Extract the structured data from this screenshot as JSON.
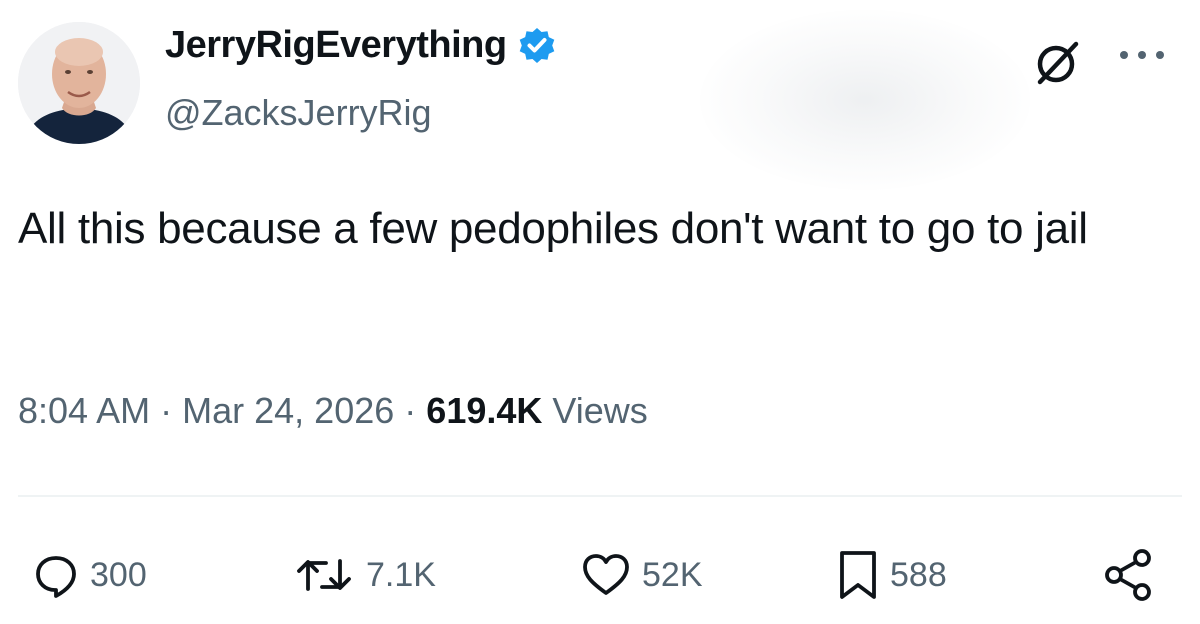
{
  "author": {
    "display_name": "JerryRigEverything",
    "handle": "@ZacksJerryRig",
    "verified": true
  },
  "tweet": {
    "text": "All this because a few pedophiles don't want to go to jail",
    "time": "8:04 AM",
    "separator": "·",
    "date": "Mar 24, 2026",
    "views_count": "619.4K",
    "views_label": "Views"
  },
  "actions": {
    "replies": "300",
    "reposts": "7.1K",
    "likes": "52K",
    "bookmarks": "588"
  },
  "icons": {
    "header": [
      "grok-icon",
      "more-icon"
    ],
    "actions": [
      "reply-icon",
      "repost-icon",
      "like-icon",
      "bookmark-icon",
      "share-icon"
    ]
  },
  "colors": {
    "verified_blue": "#1d9bf0",
    "secondary_text": "#536471",
    "primary_text": "#0f1419"
  }
}
